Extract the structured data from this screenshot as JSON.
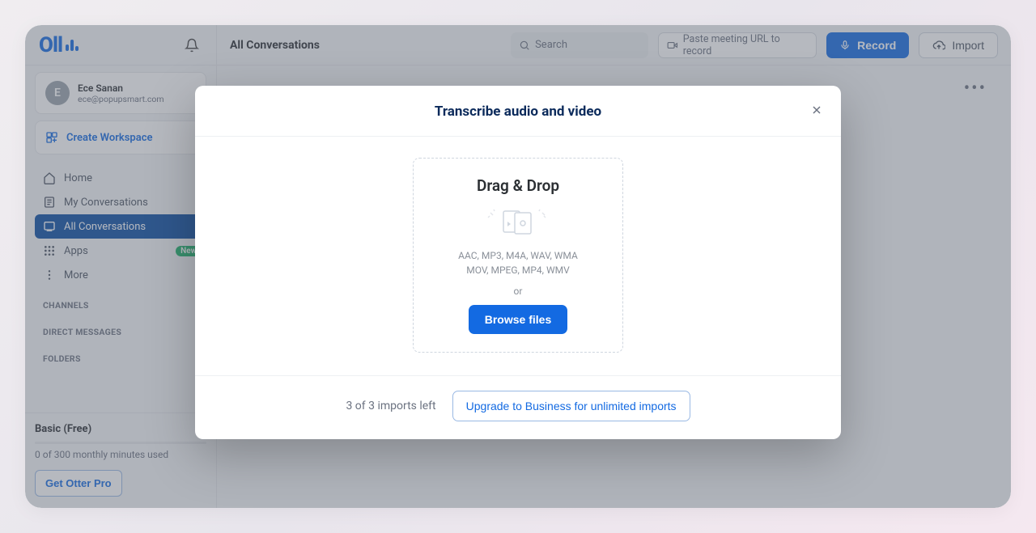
{
  "header": {
    "title": "All Conversations",
    "search_placeholder": "Search",
    "paste_placeholder": "Paste meeting URL to record",
    "record_label": "Record",
    "import_label": "Import"
  },
  "user": {
    "initial": "E",
    "name": "Ece Sanan",
    "email": "ece@popupsmart.com"
  },
  "sidebar": {
    "create_workspace_label": "Create Workspace",
    "items": [
      {
        "label": "Home"
      },
      {
        "label": "My Conversations"
      },
      {
        "label": "All Conversations"
      },
      {
        "label": "Apps"
      },
      {
        "label": "More"
      }
    ],
    "new_badge": "New",
    "section_channels": "CHANNELS",
    "section_dms": "DIRECT MESSAGES",
    "section_folders": "FOLDERS"
  },
  "plan": {
    "name": "Basic (Free)",
    "usage_text": "0 of 300 monthly minutes used",
    "get_pro_label": "Get Otter Pro"
  },
  "main": {
    "date_label": ""
  },
  "modal": {
    "title": "Transcribe audio and video",
    "dropzone_title": "Drag & Drop",
    "formats_line1": "AAC, MP3, M4A, WAV, WMA",
    "formats_line2": "MOV, MPEG, MP4, WMV",
    "or_label": "or",
    "browse_label": "Browse files",
    "imports_left": "3 of 3 imports left",
    "upgrade_label": "Upgrade to Business for unlimited imports"
  },
  "colors": {
    "accent": "#136ae2",
    "nav_active_bg": "#0a4ea3"
  }
}
